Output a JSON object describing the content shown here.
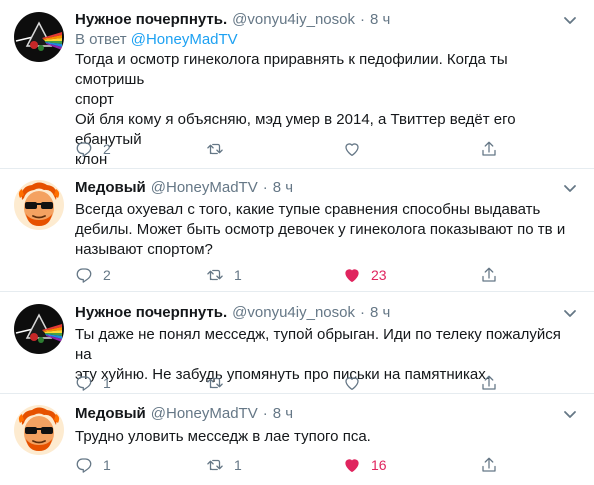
{
  "tweets": [
    {
      "name": "Нужное почерпнуть.",
      "handle": "@vonyu4iy_nosok",
      "dot": "·",
      "time": "8 ч",
      "reply_prefix": "В ответ ",
      "reply_mention": "@HoneyMadTV",
      "text": "Тогда и осмотр гинеколога приравнять к педофилии. Когда ты смотришь\nспорт\nОй бля кому я объясняю, мэд умер в 2014, а Твиттер ведёт его ебанутый\nклон",
      "replies": "2",
      "retweets": "",
      "likes": "",
      "liked": false
    },
    {
      "name": "Медовый",
      "handle": "@HoneyMadTV",
      "dot": "·",
      "time": "8 ч",
      "text": "Всегда охуевал с того, какие тупые сравнения способны выдавать\nдебилы. Может быть осмотр девочек у гинеколога показывают по тв и\nназывают спортом?",
      "replies": "2",
      "retweets": "1",
      "likes": "23",
      "liked": true
    },
    {
      "name": "Нужное почерпнуть.",
      "handle": "@vonyu4iy_nosok",
      "dot": "·",
      "time": "8 ч",
      "text": "Ты даже не понял месседж, тупой обрыган. Иди по телеку пожалуйся на\nэту хуйню. Не забудь упомянуть про письки на памятниках.",
      "replies": "1",
      "retweets": "",
      "likes": "",
      "liked": false
    },
    {
      "name": "Медовый",
      "handle": "@HoneyMadTV",
      "dot": "·",
      "time": "8 ч",
      "text": "Трудно уловить месседж в лае тупого пса.",
      "replies": "1",
      "retweets": "1",
      "likes": "16",
      "liked": true
    }
  ],
  "colors": {
    "accent": "#1da1f2",
    "muted": "#657786",
    "like": "#e0245e",
    "divider": "#e6ecf0"
  },
  "icons": [
    "chevron-down-icon",
    "reply-icon",
    "retweet-icon",
    "heart-icon",
    "share-icon",
    "pink-floyd-prism-avatar",
    "cartoon-sunglasses-avatar"
  ]
}
